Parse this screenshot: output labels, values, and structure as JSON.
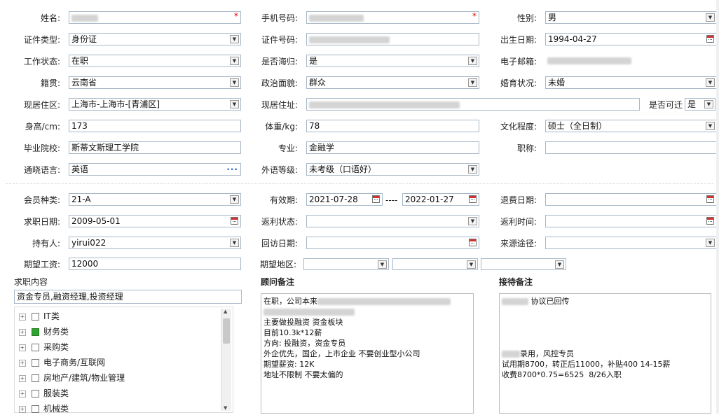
{
  "section1": {
    "name_label": "姓名:",
    "phone_label": "手机号码:",
    "gender_label": "性别:",
    "gender_value": "男",
    "idtype_label": "证件类型:",
    "idtype_value": "身份证",
    "idno_label": "证件号码:",
    "birth_label": "出生日期:",
    "birth_value": "1994-04-27",
    "work_label": "工作状态:",
    "work_value": "在职",
    "returnee_label": "是否海归:",
    "returnee_value": "是",
    "email_label": "电子邮箱:",
    "native_label": "籍贯:",
    "native_value": "云南省",
    "political_label": "政治面貌:",
    "political_value": "群众",
    "marital_label": "婚育状况:",
    "marital_value": "未婚",
    "residence_label": "现居住区:",
    "residence_value": "上海市-上海市-[青浦区]",
    "address_label": "现居住址:",
    "relocate_label": "是否可迁",
    "relocate_value": "是",
    "height_label": "身高/cm:",
    "height_value": "173",
    "weight_label": "体重/kg:",
    "weight_value": "78",
    "education_label": "文化程度:",
    "education_value": "硕士（全日制）",
    "school_label": "毕业院校:",
    "school_value": "斯蒂文斯理工学院",
    "major_label": "专业:",
    "major_value": "金融学",
    "title_label": "职称:",
    "title_value": "",
    "language_label": "通晓语言:",
    "language_value": "英语",
    "foreign_label": "外语等级:",
    "foreign_value": "未考级（口语好）"
  },
  "section2": {
    "member_label": "会员种类:",
    "member_value": "21-A",
    "valid_label": "有效期:",
    "valid_from": "2021-07-28",
    "valid_sep": "----",
    "valid_to": "2022-01-27",
    "refund_label": "退费日期:",
    "jobdate_label": "求职日期:",
    "jobdate_value": "2009-05-01",
    "rebate_label": "返利状态:",
    "rebatetime_label": "返利时间:",
    "holder_label": "持有人:",
    "holder_value": "yirui022",
    "visit_label": "回访日期:",
    "source_label": "来源途径:",
    "salary_label": "期望工资:",
    "salary_value": "12000",
    "region_label": "期望地区:"
  },
  "job_panel": {
    "title": "求职内容",
    "selected": "资金专员,融资经理,投资经理",
    "items": [
      {
        "label": "IT类",
        "checked": false
      },
      {
        "label": "财务类",
        "checked": true
      },
      {
        "label": "采购类",
        "checked": false
      },
      {
        "label": "电子商务/互联网",
        "checked": false
      },
      {
        "label": "房地产/建筑/物业管理",
        "checked": false
      },
      {
        "label": "服装类",
        "checked": false
      },
      {
        "label": "机械类",
        "checked": false
      }
    ]
  },
  "advisor_panel": {
    "title": "顾问备注",
    "line1": "在职，公司本来",
    "line3": "主要做投融资 资金板块",
    "line4": "目前10.3k*12薪",
    "line5": "方向: 投融资，资金专员",
    "line6": "外企优先，国企，上市企业 不要创业型小公司",
    "line7": "期望薪资: 12K",
    "line8": "地址不限制 不要太偏的"
  },
  "reception_panel": {
    "title": "接待备注",
    "line1": "协议已回传",
    "line2": "录用，风控专员",
    "line3": "试用期8700，转正后11000，补贴400 14-15薪",
    "line4": "收费8700*0.75=6525  8/26入职"
  }
}
